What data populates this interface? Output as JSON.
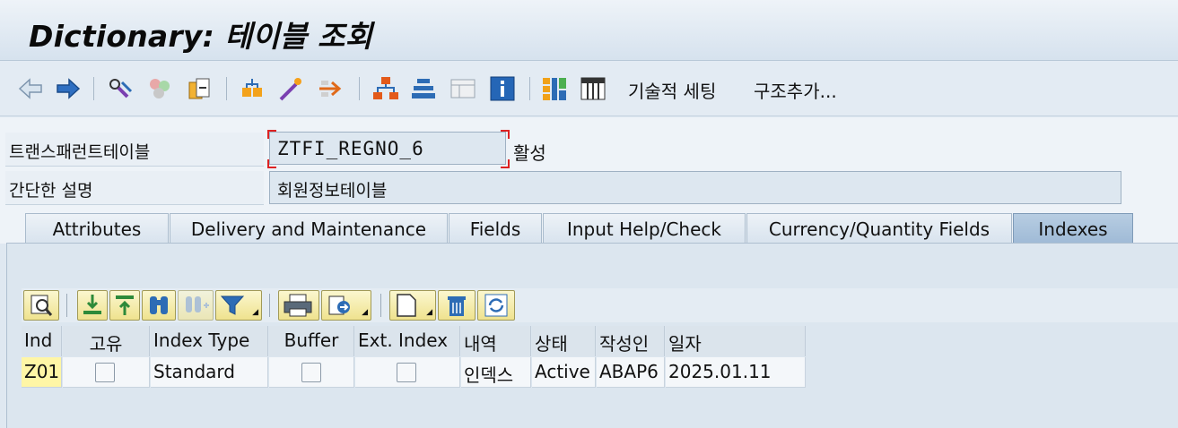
{
  "window": {
    "title": "Dictionary: 테이블 조회"
  },
  "toolbar": {
    "icons": [
      "back-arrow-icon",
      "forward-arrow-icon",
      "display-change-icon",
      "other-object-icon",
      "activate-icon",
      "where-used-icon",
      "object-list-icon",
      "navigation-window-icon",
      "hierarchy-icon",
      "stacked-list-icon",
      "layout-icon",
      "info-icon",
      "grid-view-icon",
      "table-view-icon"
    ],
    "technical_settings": "기술적 세팅",
    "append_structure": "구조추가..."
  },
  "header": {
    "table_label": "트랜스패런트테이블",
    "table_name": "ZTFI_REGNO_6",
    "status": "활성",
    "desc_label": "간단한 설명",
    "description": "회원정보테이블"
  },
  "tabs": [
    {
      "label": "Attributes",
      "active": false
    },
    {
      "label": "Delivery and Maintenance",
      "active": false
    },
    {
      "label": "Fields",
      "active": false
    },
    {
      "label": "Input Help/Check",
      "active": false
    },
    {
      "label": "Currency/Quantity Fields",
      "active": false
    },
    {
      "label": "Indexes",
      "active": true
    }
  ],
  "grid_toolbar": {
    "buttons": [
      "details-icon",
      "align-bottom-icon",
      "align-top-icon",
      "binoculars-icon",
      "find-next-icon",
      "filter-icon",
      "print-icon",
      "export-icon",
      "create-icon",
      "delete-icon",
      "refresh-icon"
    ]
  },
  "grid": {
    "columns": [
      "Ind",
      "고유",
      "Index Type",
      "Buffer",
      "Ext. Index",
      "내역",
      "상태",
      "작성인",
      "일자"
    ],
    "rows": [
      {
        "ind": "Z01",
        "unique": false,
        "index_type": "Standard",
        "buffer": false,
        "ext_index": false,
        "desc": "인덱스",
        "status": "Active",
        "author": "ABAP6",
        "date": "2025.01.11"
      }
    ]
  },
  "colors": {
    "title_bg": "#dfe8f1",
    "active_tab": "#a9c3dc",
    "key_cell": "#fff6a6",
    "required_bracket": "#dd2222"
  }
}
